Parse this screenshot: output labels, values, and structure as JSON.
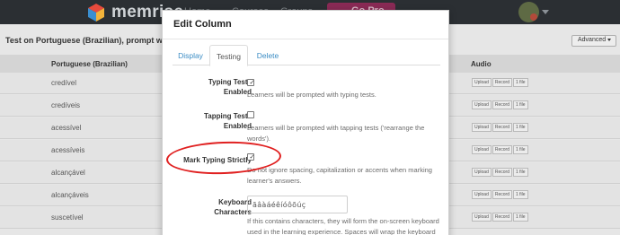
{
  "topnav": {
    "logo_text": "memrise",
    "links": [
      "Home",
      "Courses",
      "Groups"
    ],
    "go_pro_label": "Go Pro"
  },
  "page": {
    "title": "Test on Portuguese (Brazilian), prompt with English",
    "advanced_label": "Advanced",
    "columns": {
      "language": "Portuguese (Brazilian)",
      "audio": "Audio"
    },
    "row_buttons": {
      "upload": "Upload",
      "record": "Record",
      "files": "1 file"
    },
    "rows": [
      "credível",
      "credíveis",
      "acessível",
      "acessíveis",
      "alcançável",
      "alcançáveis",
      "suscetível"
    ]
  },
  "modal": {
    "title": "Edit Column",
    "tabs": [
      "Display",
      "Testing",
      "Delete"
    ],
    "active_tab": "Testing",
    "typing_tests": {
      "label": "Typing Tests Enabled",
      "checked": true,
      "help": "Learners will be prompted with typing tests."
    },
    "tapping_tests": {
      "label": "Tapping Tests Enabled",
      "checked": false,
      "help": "Learners will be prompted with tapping tests ('rearrange the words')."
    },
    "mark_typing_strictly": {
      "label": "Mark Typing Strictly",
      "checked": true,
      "help": "Do not ignore spacing, capitalization or accents when marking learner's answers."
    },
    "keyboard_characters": {
      "label": "Keyboard Characters",
      "value": "ãâàáéêíóôõúç",
      "help": "If this contains characters, they will form the on-screen keyboard used in the learning experience. Spaces will wrap the keyboard"
    }
  },
  "colors": {
    "nav_bg": "#2b2f33",
    "go_pro": "#8a2a55",
    "link": "#3c8dc5",
    "annotation": "#e02020"
  }
}
